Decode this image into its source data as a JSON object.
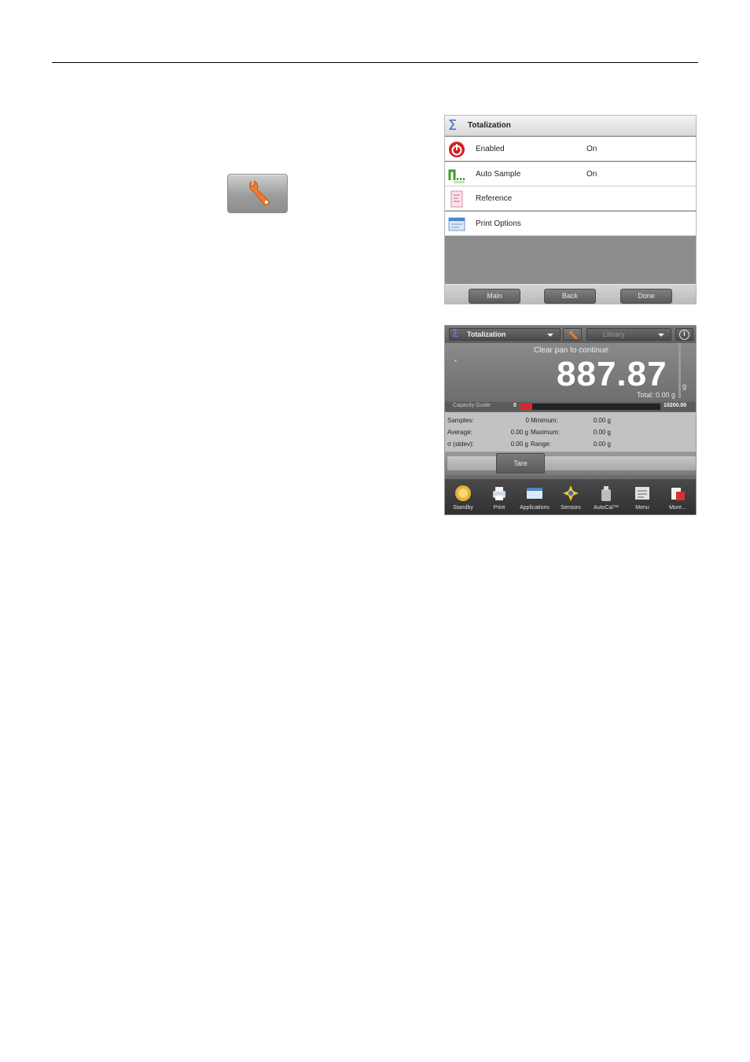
{
  "screen1": {
    "title": "Totalization",
    "rows": [
      {
        "label": "Enabled",
        "value": "On",
        "icon": "power-icon"
      },
      {
        "label": "Auto Sample",
        "value": "On",
        "icon": "auto-sample-icon"
      },
      {
        "label": "Reference",
        "value": "",
        "icon": "reference-icon"
      },
      {
        "label": "Print Options",
        "value": "",
        "icon": "print-options-icon"
      }
    ],
    "buttons": {
      "main": "Main",
      "back": "Back",
      "done": "Done"
    }
  },
  "screen2": {
    "app_name": "Totalization",
    "library_label": "Library",
    "info_glyph": "i",
    "message": "Clear pan to continue",
    "stable_marker": "*",
    "reading": "887.87",
    "unit": "g",
    "total": "Total: 0.00 g",
    "capacity": {
      "label": "Capacity Guide",
      "min": "0",
      "max": "10200.00",
      "fill_fraction": 0.087
    },
    "stats": {
      "samples_label": "Samples:",
      "samples_value": "0",
      "average_label": "Average:",
      "average_value": "0.00 g",
      "stdev_label": "σ (stdev):",
      "stdev_value": "0.00 g",
      "minimum_label": "Minimum:",
      "minimum_value": "0.00 g",
      "maximum_label": "Maximum:",
      "maximum_value": "0.00 g",
      "range_label": "Range:",
      "range_value": "0.00 g"
    },
    "tare_label": "Tare",
    "nav": [
      "Standby",
      "Print",
      "Applications",
      "Sensors",
      "AutoCal™",
      "Menu",
      "More..."
    ]
  },
  "colors": {
    "accent_orange": "#e8772e",
    "capacity_red": "#e0242b",
    "sigma_blue": "#3c6fc0"
  }
}
